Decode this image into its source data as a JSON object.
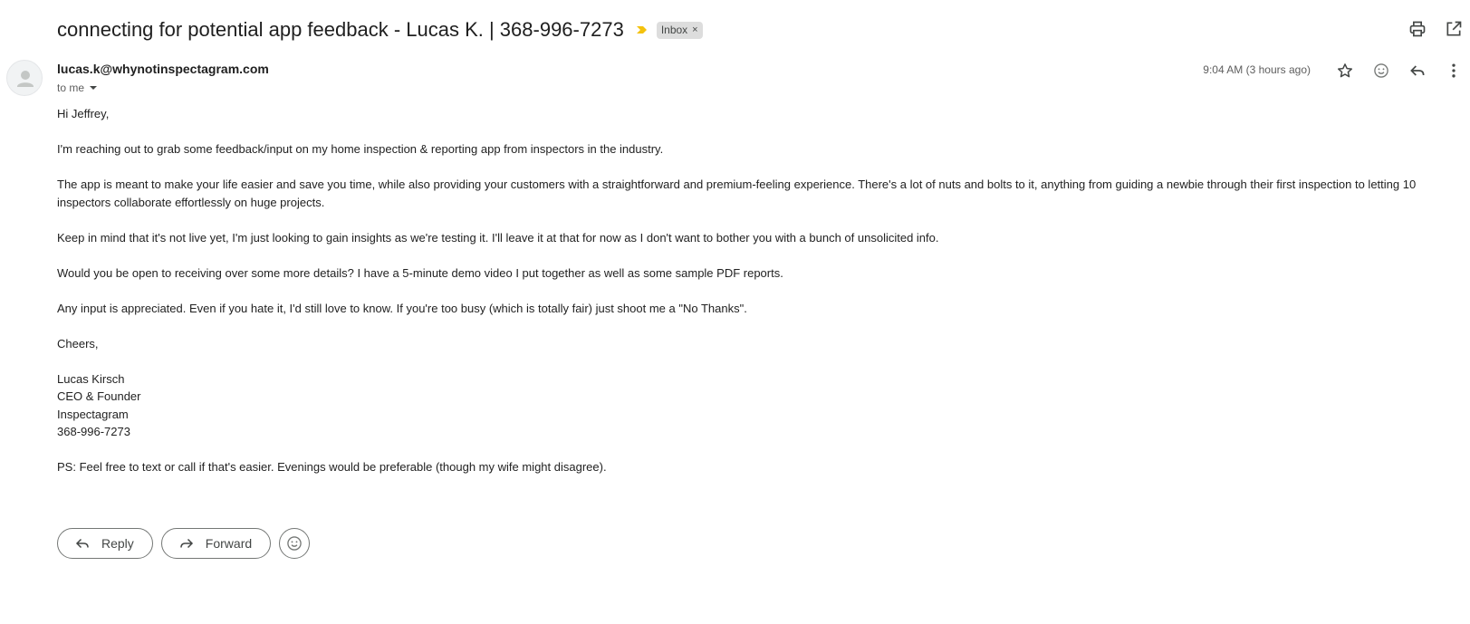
{
  "subject": "connecting for potential app feedback - Lucas K. | 368-996-7273",
  "label_chip": {
    "text": "Inbox",
    "close": "×"
  },
  "icons": {
    "top_actions": [
      "print-icon",
      "open-in-new-window-icon"
    ],
    "message_actions": [
      "star-icon",
      "emoji-reaction-icon",
      "reply-icon",
      "more-vert-icon"
    ],
    "importance": "importance-marker-icon",
    "colors": {
      "importance": "#f4c20d",
      "chip_bg": "#dddddd"
    }
  },
  "sender": "lucas.k@whynotinspectagram.com",
  "recipient": "to me",
  "time": "9:04 AM (3 hours ago)",
  "body": {
    "greeting": "Hi Jeffrey,",
    "paragraphs": [
      "I'm reaching out to grab some feedback/input on my home inspection & reporting app from inspectors in the industry.",
      "The app is meant to make your life easier and save you time, while also providing your customers with a straightforward and premium-feeling experience. There's a lot of nuts and bolts to it, anything from guiding a newbie through their first inspection to letting 10 inspectors collaborate effortlessly on huge projects.",
      "Keep in mind that it's not live yet, I'm just looking to gain insights as we're testing it. I'll leave it at that for now as I don't want to bother you with a bunch of unsolicited info.",
      "Would you be open to receiving over some more details? I have a 5-minute demo video I put together as well as some sample PDF reports.",
      "Any input is appreciated. Even if you hate it, I'd still love to know. If you're too busy (which is totally fair) just shoot me a \"No Thanks\"."
    ],
    "closing": "Cheers,",
    "signature": [
      "Lucas Kirsch",
      "CEO & Founder",
      "Inspectagram",
      "368-996-7273"
    ],
    "ps": "PS: Feel free to text or call if that's easier. Evenings would be preferable (though my wife might disagree)."
  },
  "buttons": {
    "reply": "Reply",
    "forward": "Forward"
  }
}
